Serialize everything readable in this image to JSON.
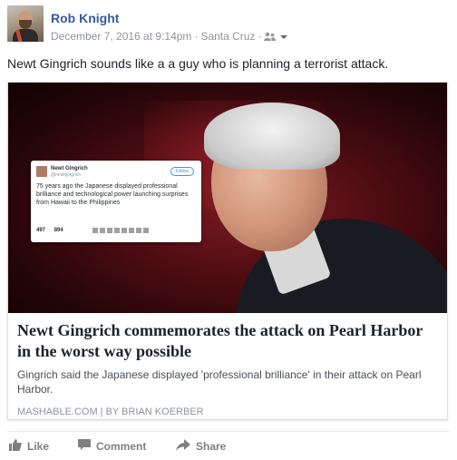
{
  "post": {
    "author": "Rob Knight",
    "date": "December 7, 2016 at 9:14pm",
    "location": "Santa Cruz",
    "audience_icon": "friends-icon",
    "menu_icon": "chevron-down-icon",
    "text": "Newt Gingrich sounds like a a guy who is planning a terrorist attack."
  },
  "link_card": {
    "title": "Newt Gingrich commemorates the attack on Pearl Harbor in the worst way possible",
    "description": "Gingrich said the Japanese displayed 'professional brilliance' in their attack on Pearl Harbor.",
    "source": "MASHABLE.COM | BY BRIAN KOERBER",
    "embedded_tweet": {
      "name": "Newt Gingrich",
      "handle": "@newtgingrich",
      "follow_label": "Follow",
      "body": "75 years ago the Japanese displayed professional brilliance and technological power launching surprises from Hawaii to the Philippines",
      "retweets": "497",
      "likes": "894"
    }
  },
  "actions": {
    "like": "Like",
    "comment": "Comment",
    "share": "Share"
  },
  "colors": {
    "author_blue": "#365899",
    "meta_gray": "#90949c",
    "action_gray": "#7f7f7f"
  }
}
